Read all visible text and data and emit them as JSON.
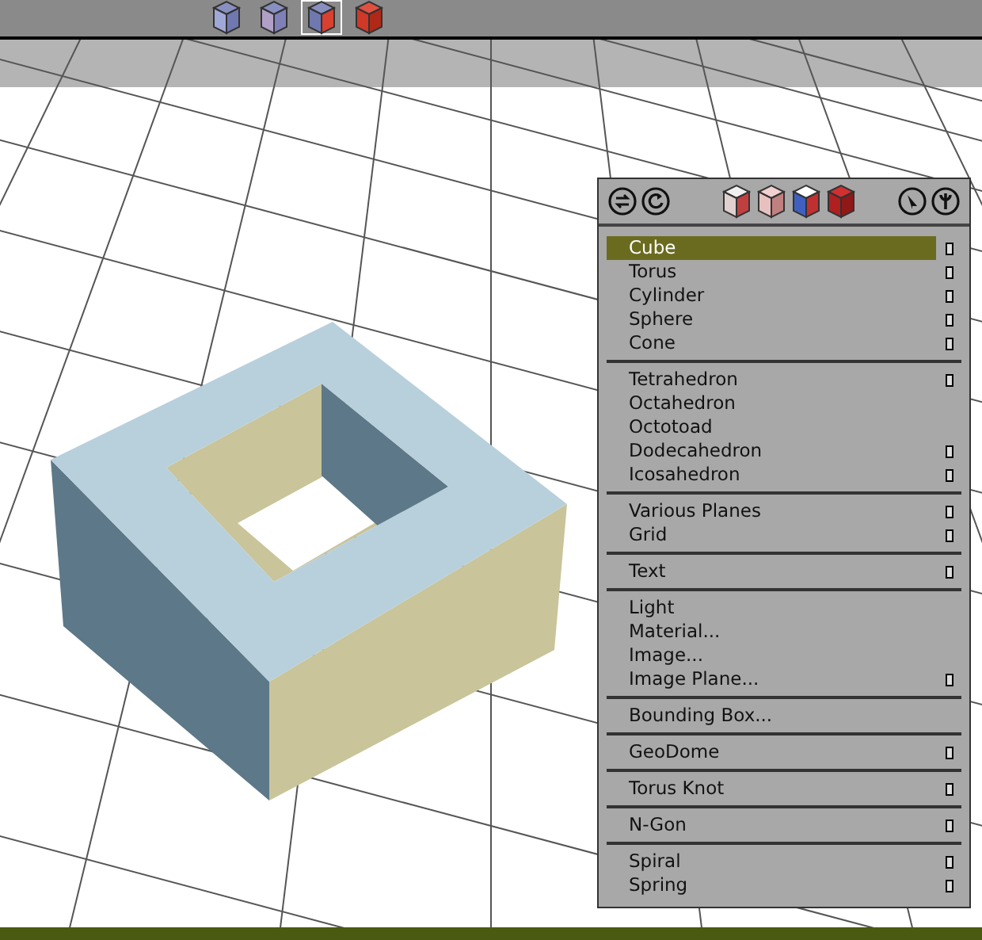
{
  "toolbar": {
    "view_modes": [
      {
        "selected": false
      },
      {
        "selected": false
      },
      {
        "selected": true
      },
      {
        "selected": false
      }
    ]
  },
  "menu": {
    "sections": [
      {
        "items": [
          {
            "label": "Cube",
            "selected": true,
            "has_options": true
          },
          {
            "label": "Torus",
            "selected": false,
            "has_options": true
          },
          {
            "label": "Cylinder",
            "selected": false,
            "has_options": true
          },
          {
            "label": "Sphere",
            "selected": false,
            "has_options": true
          },
          {
            "label": "Cone",
            "selected": false,
            "has_options": true
          }
        ]
      },
      {
        "items": [
          {
            "label": "Tetrahedron",
            "selected": false,
            "has_options": true
          },
          {
            "label": "Octahedron",
            "selected": false,
            "has_options": false
          },
          {
            "label": "Octotoad",
            "selected": false,
            "has_options": false
          },
          {
            "label": "Dodecahedron",
            "selected": false,
            "has_options": true
          },
          {
            "label": "Icosahedron",
            "selected": false,
            "has_options": true
          }
        ]
      },
      {
        "items": [
          {
            "label": "Various Planes",
            "selected": false,
            "has_options": true
          },
          {
            "label": "Grid",
            "selected": false,
            "has_options": true
          }
        ]
      },
      {
        "items": [
          {
            "label": "Text",
            "selected": false,
            "has_options": true
          }
        ]
      },
      {
        "items": [
          {
            "label": "Light",
            "selected": false,
            "has_options": false
          },
          {
            "label": "Material...",
            "selected": false,
            "has_options": false
          },
          {
            "label": "Image...",
            "selected": false,
            "has_options": false
          },
          {
            "label": "Image Plane...",
            "selected": false,
            "has_options": true
          }
        ]
      },
      {
        "items": [
          {
            "label": "Bounding Box...",
            "selected": false,
            "has_options": false
          }
        ]
      },
      {
        "items": [
          {
            "label": "GeoDome",
            "selected": false,
            "has_options": true
          }
        ]
      },
      {
        "items": [
          {
            "label": "Torus Knot",
            "selected": false,
            "has_options": true
          }
        ]
      },
      {
        "items": [
          {
            "label": "N-Gon",
            "selected": false,
            "has_options": true
          }
        ]
      },
      {
        "items": [
          {
            "label": "Spiral",
            "selected": false,
            "has_options": true
          },
          {
            "label": "Spring",
            "selected": false,
            "has_options": true
          }
        ]
      }
    ]
  }
}
